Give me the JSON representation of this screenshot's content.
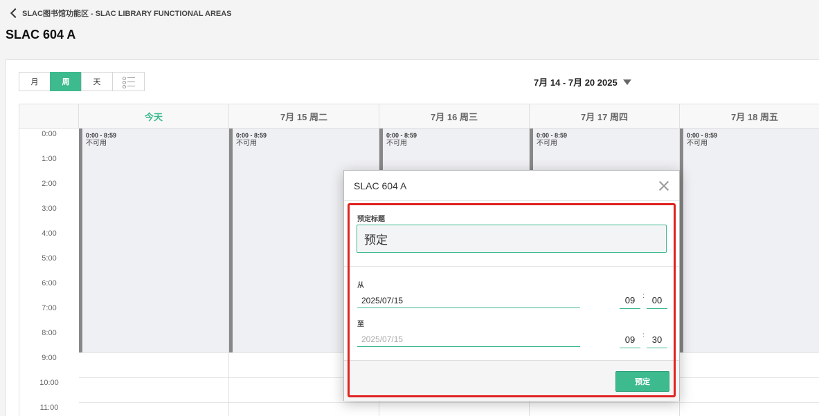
{
  "breadcrumb": {
    "text": "SLAC图书馆功能区 - SLAC LIBRARY FUNCTIONAL AREAS"
  },
  "page": {
    "title": "SLAC 604 A"
  },
  "views": {
    "month": "月",
    "week": "周",
    "day": "天",
    "active": "week"
  },
  "range": {
    "label": "7月 14 - 7月 20 2025"
  },
  "days": [
    {
      "label": "今天",
      "today": true
    },
    {
      "label": "7月 15 周二",
      "today": false
    },
    {
      "label": "7月 16 周三",
      "today": false
    },
    {
      "label": "7月 17 周四",
      "today": false
    },
    {
      "label": "7月 18 周五",
      "today": false
    }
  ],
  "hours": [
    "0:00",
    "1:00",
    "2:00",
    "3:00",
    "4:00",
    "5:00",
    "6:00",
    "7:00",
    "8:00",
    "9:00",
    "10:00",
    "11:00"
  ],
  "unavailable": {
    "time": "0:00 - 8:59",
    "label": "不可用"
  },
  "modal": {
    "title": "SLAC 604 A",
    "title_field_label": "预定标题",
    "title_value": "预定",
    "from_label": "从",
    "from_date": "2025/07/15",
    "from_hour": "09",
    "from_minute": "00",
    "to_label": "至",
    "to_date": "2025/07/15",
    "to_hour": "09",
    "to_minute": "30",
    "time_separator": ":",
    "submit_label": "预定"
  },
  "colors": {
    "accent": "#3dba8e",
    "highlight": "#e02020",
    "unavailable_bar": "#888888"
  }
}
